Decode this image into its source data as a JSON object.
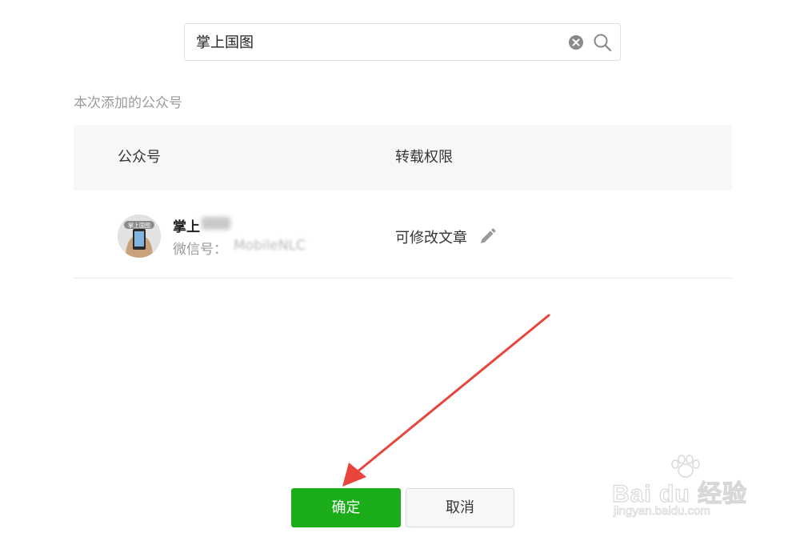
{
  "search": {
    "value": "掌上国图"
  },
  "section": {
    "title": "本次添加的公众号"
  },
  "table": {
    "headers": {
      "account": "公众号",
      "permission": "转载权限"
    },
    "rows": [
      {
        "name": "掌上",
        "wechat_label": "微信号：",
        "wechat_id": "MobileNLC",
        "permission": "可修改文章"
      }
    ]
  },
  "buttons": {
    "confirm": "确定",
    "cancel": "取消"
  },
  "watermark": {
    "brand": "Bai du 经验",
    "url": "jingyan.baidu.com"
  },
  "colors": {
    "accent_green": "#1aad19",
    "annotation_arrow": "#e8453c"
  }
}
